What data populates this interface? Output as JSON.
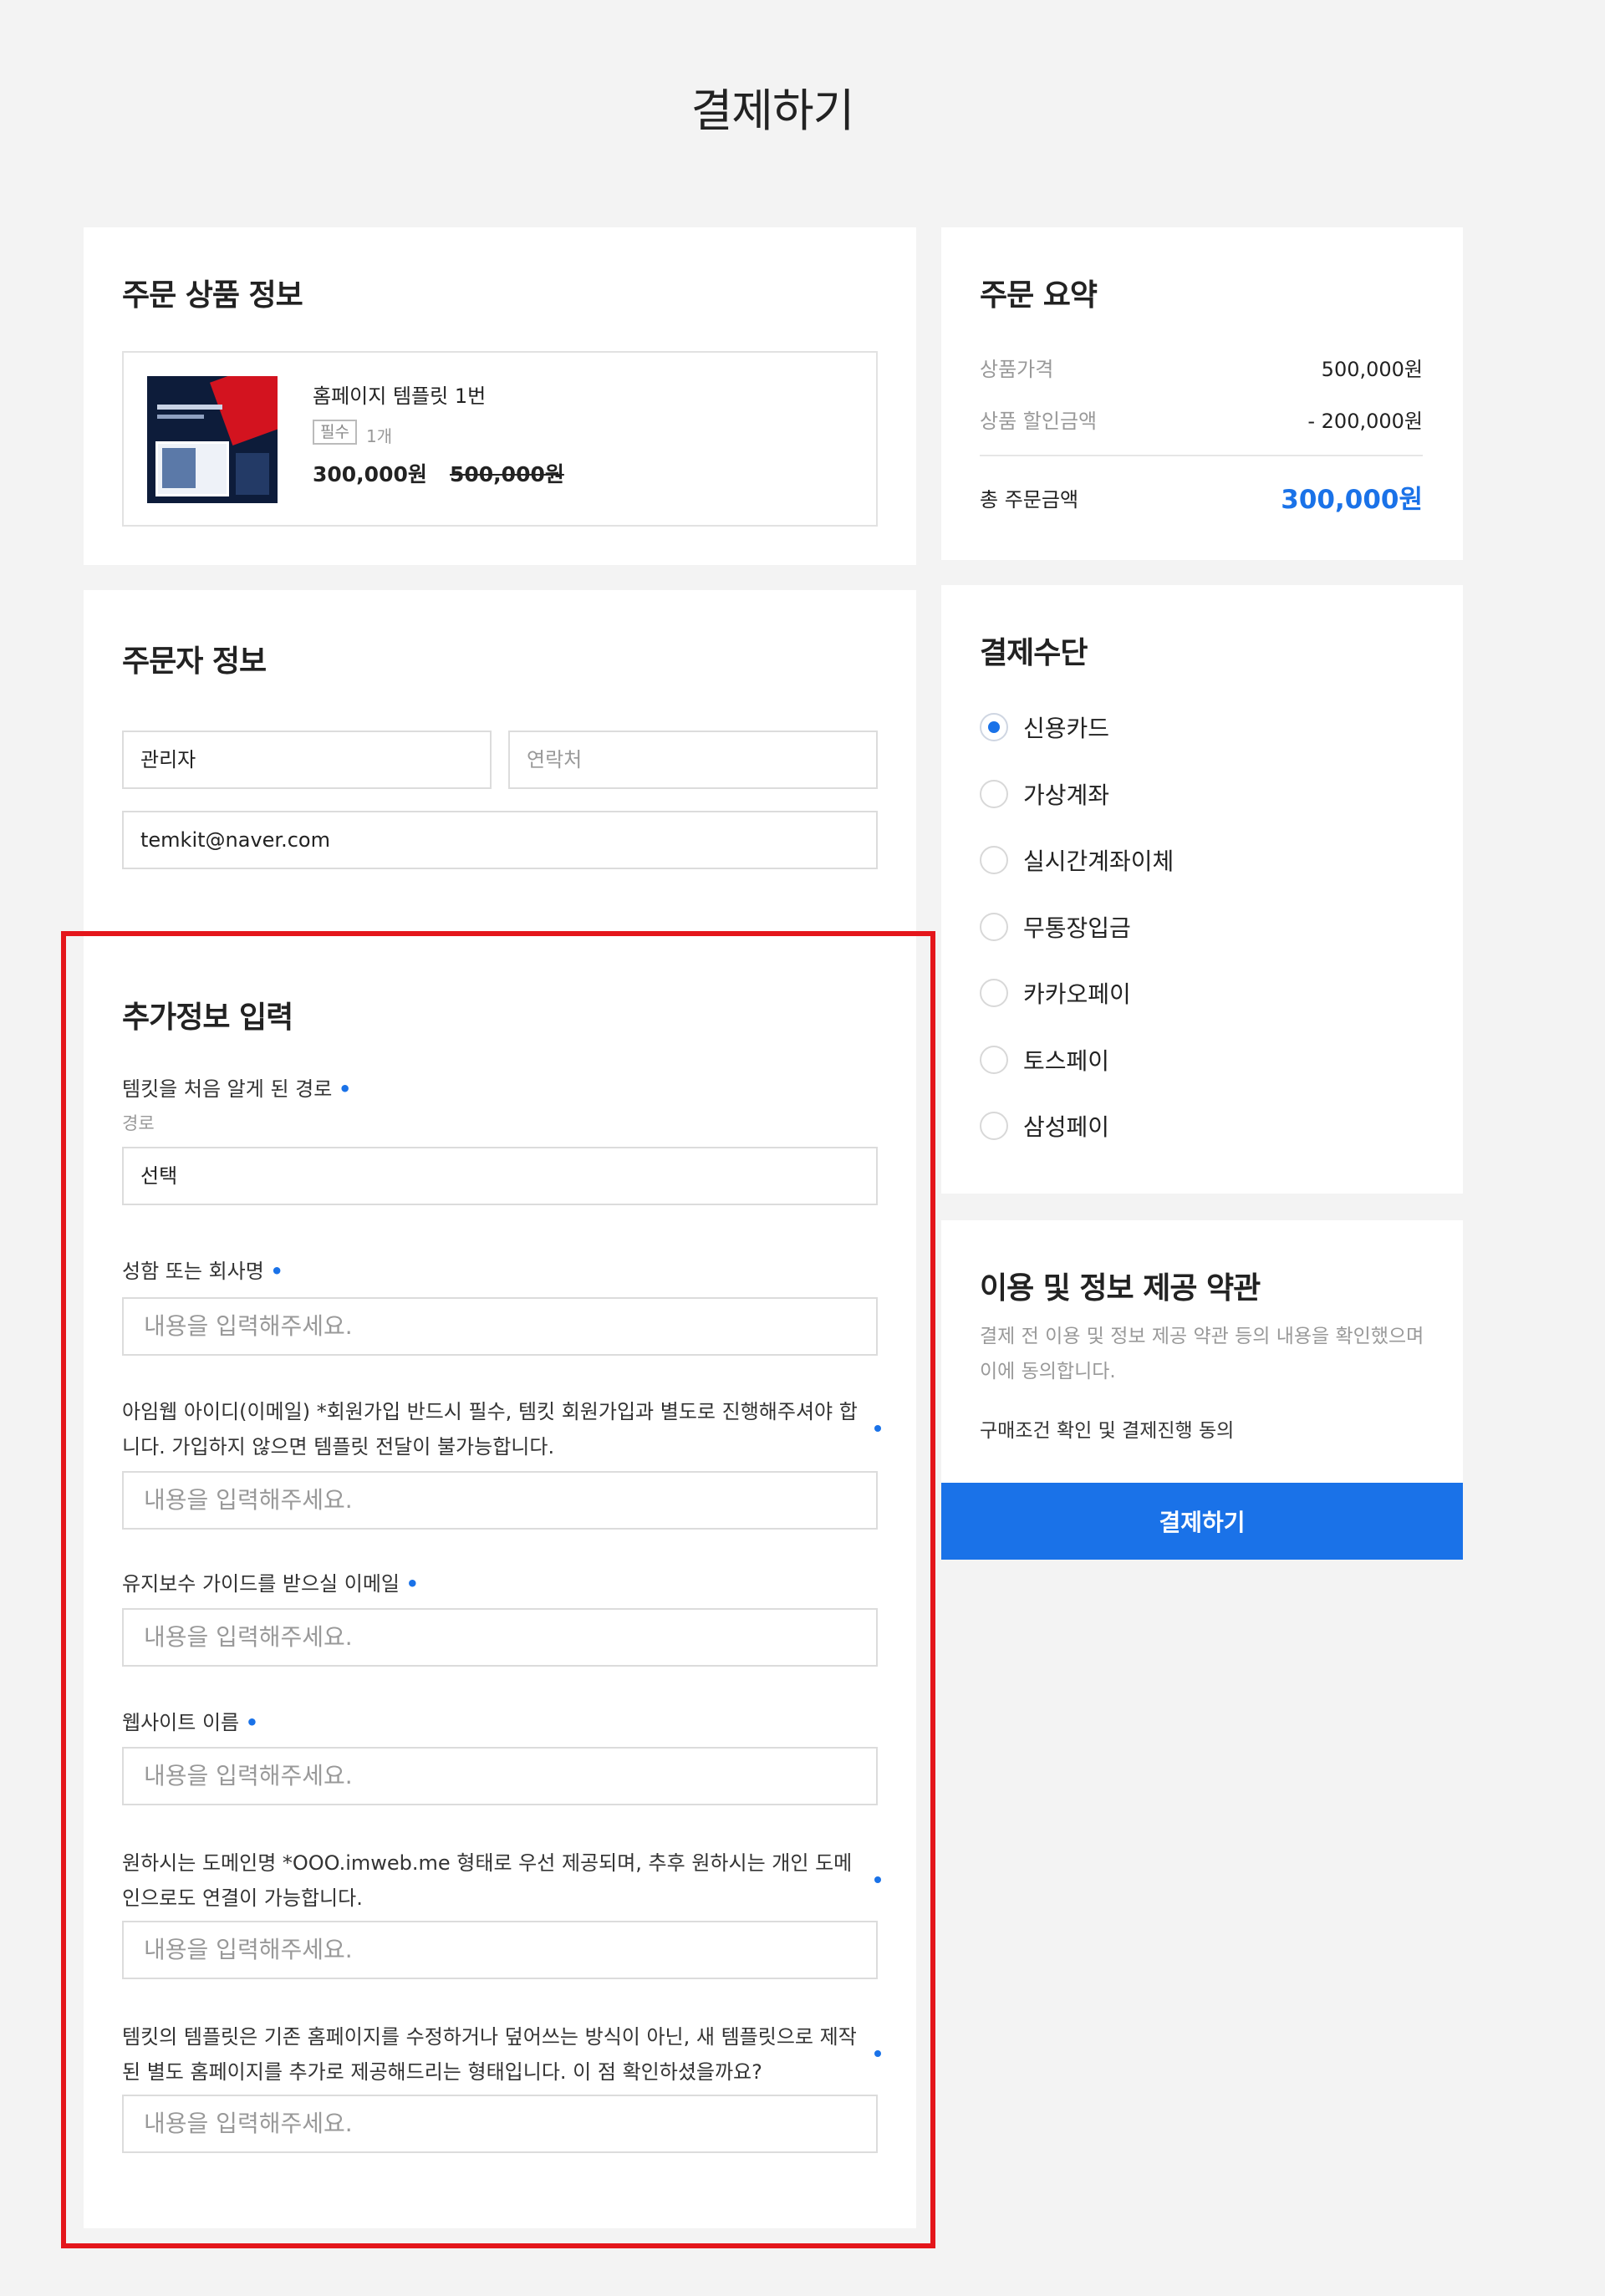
{
  "page": {
    "title": "결제하기"
  },
  "product": {
    "section_title": "주문 상품 정보",
    "name": "홈페이지 템플릿 1번",
    "required_badge": "필수",
    "quantity": "1개",
    "price": "300,000원",
    "original_price": "500,000원"
  },
  "orderer": {
    "section_title": "주문자 정보",
    "name_value": "관리자",
    "phone_placeholder": "연락처",
    "email_value": "temkit@naver.com"
  },
  "extra": {
    "section_title": "추가정보 입력",
    "route_label": "템킷을 처음 알게 된 경로",
    "route_sublabel": "경로",
    "route_select": "선택",
    "input_placeholder": "내용을 입력해주세요.",
    "questions": [
      "성함 또는 회사명",
      "아임웹 아이디(이메일) *회원가입 반드시 필수, 템킷 회원가입과 별도로 진행해주셔야 합니다. 가입하지 않으면 템플릿 전달이 불가능합니다.",
      "유지보수 가이드를 받으실 이메일",
      "웹사이트 이름",
      "원하시는 도메인명 *OOO.imweb.me 형태로 우선 제공되며, 추후 원하시는 개인 도메인으로도 연결이 가능합니다.",
      "템킷의 템플릿은 기존 홈페이지를 수정하거나 덮어쓰는 방식이 아닌, 새 템플릿으로 제작된 별도 홈페이지를 추가로 제공해드리는 형태입니다. 이 점 확인하셨을까요?"
    ],
    "required_mark": "•"
  },
  "summary": {
    "section_title": "주문 요약",
    "price_label": "상품가격",
    "price_value": "500,000원",
    "discount_label": "상품 할인금액",
    "discount_value": "- 200,000원",
    "total_label": "총 주문금액",
    "total_value": "300,000원"
  },
  "payment": {
    "section_title": "결제수단",
    "selected_index": 0,
    "options": [
      "신용카드",
      "가상계좌",
      "실시간계좌이체",
      "무통장입금",
      "카카오페이",
      "토스페이",
      "삼성페이"
    ]
  },
  "terms": {
    "section_title": "이용 및 정보 제공 약관",
    "description": "결제 전 이용 및 정보 제공 약관 등의 내용을 확인했으며 이에 동의합니다.",
    "agree_label": "구매조건 확인 및 결제진행 동의"
  },
  "checkout": {
    "button_label": "결제하기"
  },
  "colors": {
    "accent": "#1a72e8",
    "highlight": "#e4161b",
    "background": "#f3f3f3"
  }
}
